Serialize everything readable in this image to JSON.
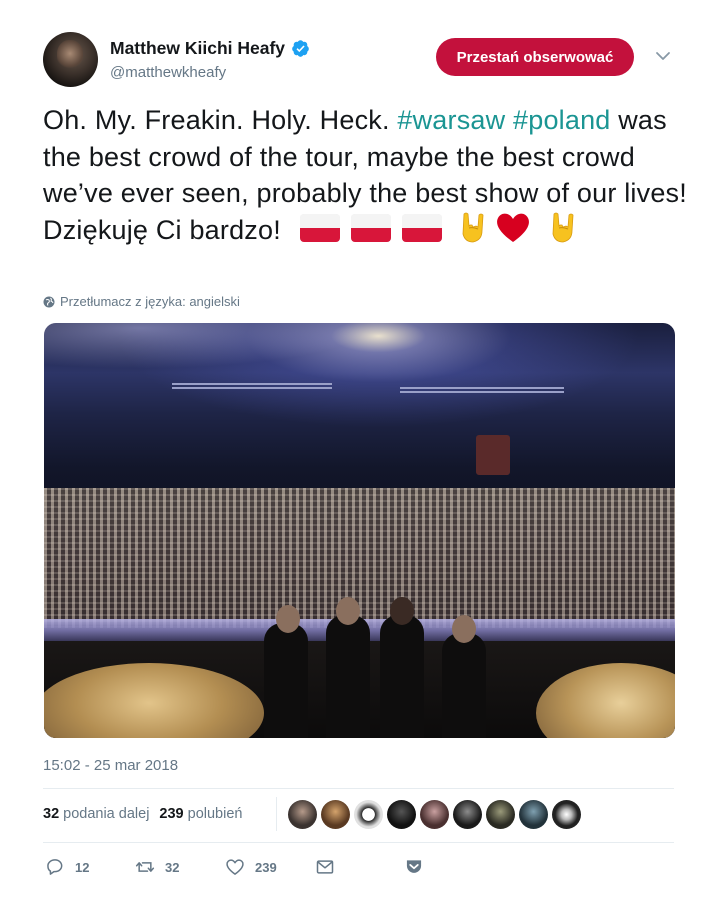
{
  "user": {
    "display_name": "Matthew Kiichi Heafy",
    "handle": "@matthewkheafy",
    "verified": true
  },
  "follow_button": {
    "label": "Przestań obserwować",
    "color": "#c3113c"
  },
  "tweet": {
    "text_part1": "Oh. My. Freakin. Holy. Heck. ",
    "hashtag1": "#warsaw",
    "hashtag2": "#poland",
    "text_part2": " was the best crowd of the tour, maybe the best crowd we’ve ever seen, probably the best show of our lives! Dziękuję Ci bardzo!",
    "emojis": [
      "flag-poland",
      "flag-poland",
      "flag-poland",
      "sign-of-the-horns",
      "red-heart",
      "sign-of-the-horns"
    ],
    "hashtag_color": "#1b9593"
  },
  "translation": {
    "label": "Przetłumacz z języka: angielski"
  },
  "photo": {
    "alt_subject": "band on stage in front of concert crowd"
  },
  "timestamp": "15:02 - 25 mar 2018",
  "stats": {
    "retweets_count": "32",
    "retweets_label": "podania dalej",
    "likes_count": "239",
    "likes_label": "polubień",
    "liker_avatar_count": 9
  },
  "actions": {
    "reply_count": "12",
    "retweet_count": "32",
    "like_count": "239"
  },
  "colors": {
    "text": "#14171a",
    "secondary": "#657786",
    "verified": "#1da1f2"
  }
}
